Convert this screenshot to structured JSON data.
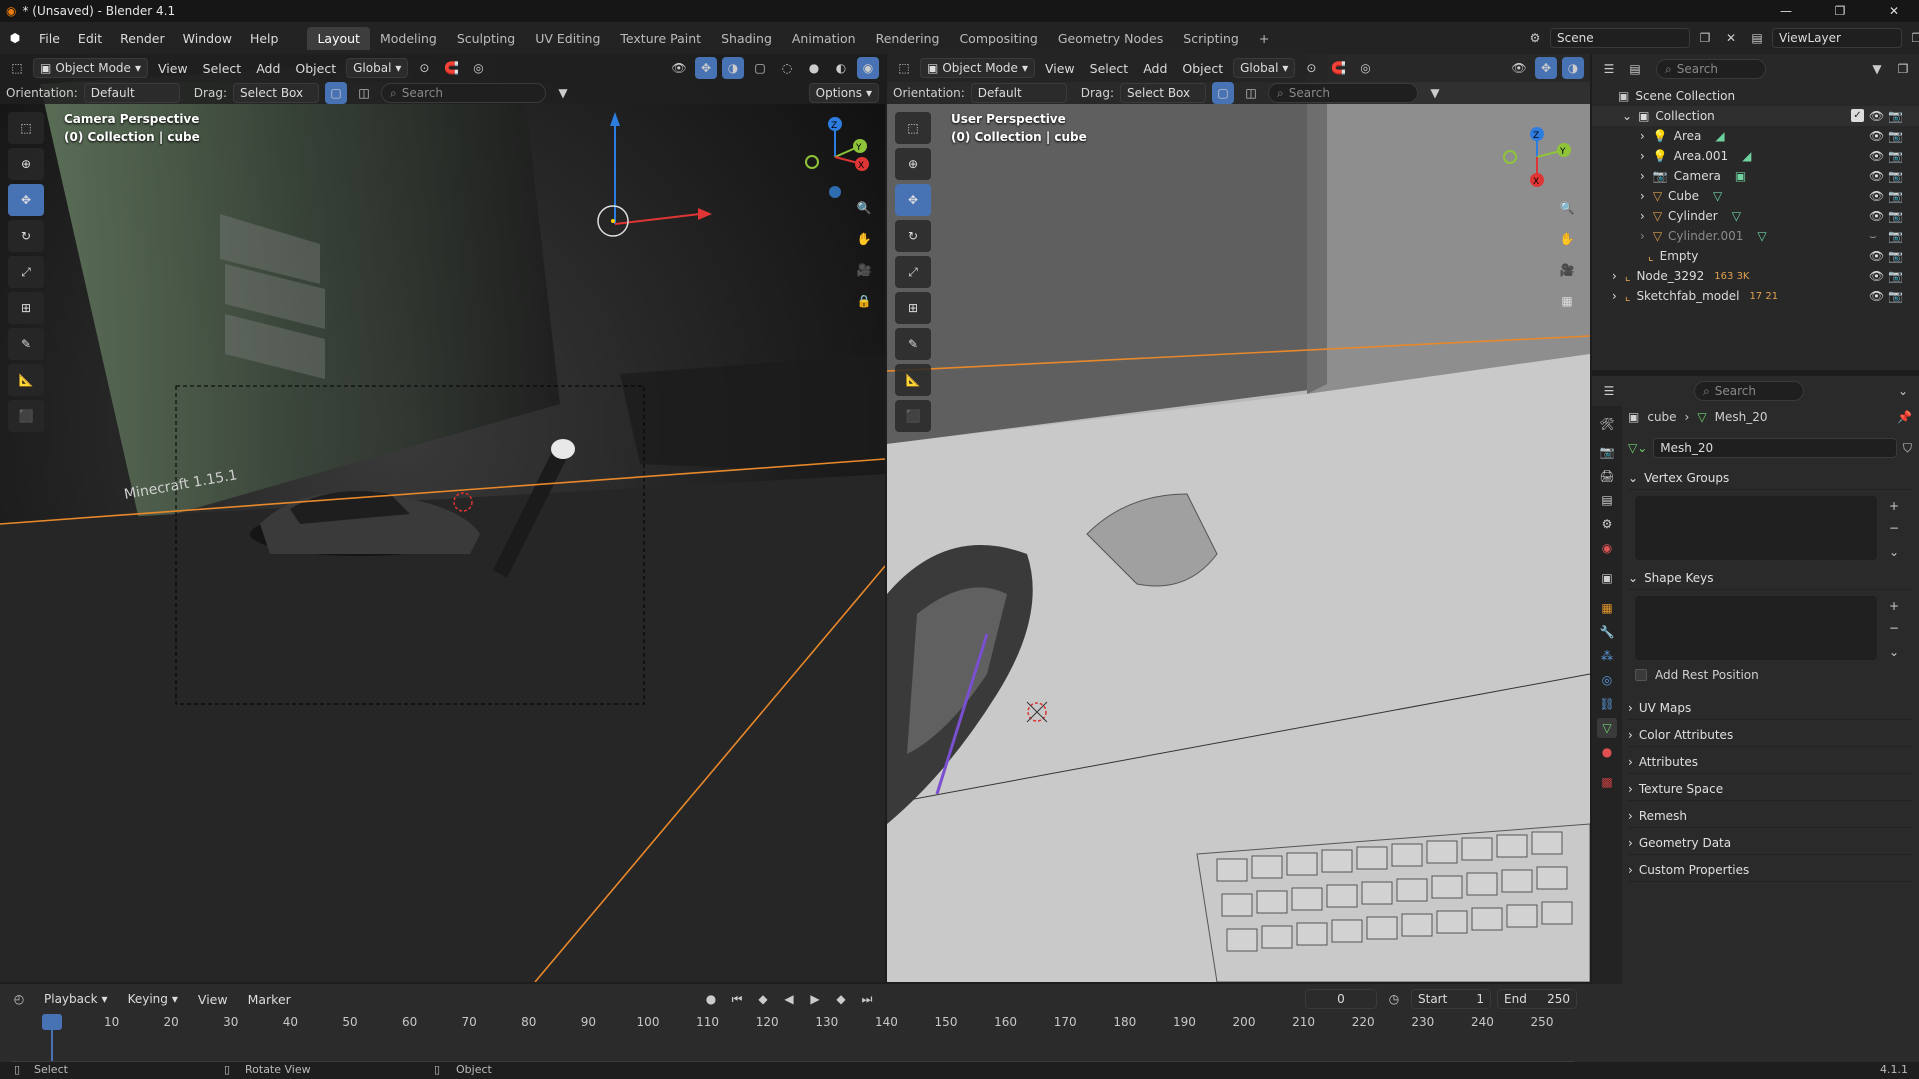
{
  "window": {
    "title": "* (Unsaved) - Blender 4.1"
  },
  "menu": {
    "items": [
      "File",
      "Edit",
      "Render",
      "Window",
      "Help"
    ]
  },
  "workspaces": [
    "Layout",
    "Modeling",
    "Sculpting",
    "UV Editing",
    "Texture Paint",
    "Shading",
    "Animation",
    "Rendering",
    "Compositing",
    "Geometry Nodes",
    "Scripting"
  ],
  "active_workspace": "Layout",
  "scene": {
    "name": "Scene",
    "view_layer": "ViewLayer"
  },
  "viewport_left": {
    "mode": "Object Mode",
    "menus": [
      "View",
      "Select",
      "Add",
      "Object"
    ],
    "transform": "Global",
    "orientation_label": "Orientation:",
    "orientation_value": "Default",
    "drag_label": "Drag:",
    "drag_value": "Select Box",
    "search_placeholder": "Search",
    "options": "Options",
    "perspective": "Camera Perspective",
    "collection_info": "(0) Collection | cube",
    "scene_text": "Minecraft 1.15.1"
  },
  "viewport_right": {
    "mode": "Object Mode",
    "menus": [
      "View",
      "Select",
      "Add",
      "Object"
    ],
    "transform": "Global",
    "orientation_label": "Orientation:",
    "orientation_value": "Default",
    "drag_label": "Drag:",
    "drag_value": "Select Box",
    "search_placeholder": "Search",
    "perspective": "User Perspective",
    "collection_info": "(0) Collection | cube"
  },
  "outliner": {
    "search_placeholder": "Search",
    "root": "Scene Collection",
    "collection": "Collection",
    "items": [
      {
        "name": "Area",
        "type": "light"
      },
      {
        "name": "Area.001",
        "type": "light"
      },
      {
        "name": "Camera",
        "type": "camera"
      },
      {
        "name": "Cube",
        "type": "mesh"
      },
      {
        "name": "Cylinder",
        "type": "mesh"
      },
      {
        "name": "Cylinder.001",
        "type": "mesh",
        "hidden": true
      },
      {
        "name": "Empty",
        "type": "empty"
      }
    ],
    "top_items": [
      {
        "name": "Node_3292",
        "badge": "163 3K"
      },
      {
        "name": "Sketchfab_model",
        "badge": "17  21"
      }
    ]
  },
  "properties": {
    "search_placeholder": "Search",
    "breadcrumb_object": "cube",
    "breadcrumb_data": "Mesh_20",
    "datablock": "Mesh_20",
    "panels_open": [
      "Vertex Groups",
      "Shape Keys"
    ],
    "add_rest_position": "Add Rest Position",
    "panels_closed": [
      "UV Maps",
      "Color Attributes",
      "Attributes",
      "Texture Space",
      "Remesh",
      "Geometry Data",
      "Custom Properties"
    ]
  },
  "timeline": {
    "menus": [
      "Playback",
      "Keying",
      "View",
      "Marker"
    ],
    "current_frame": "0",
    "start_label": "Start",
    "start": "1",
    "end_label": "End",
    "end": "250",
    "ticks": [
      "0",
      "10",
      "20",
      "30",
      "40",
      "50",
      "60",
      "70",
      "80",
      "90",
      "100",
      "110",
      "120",
      "130",
      "140",
      "150",
      "160",
      "170",
      "180",
      "190",
      "200",
      "210",
      "220",
      "230",
      "240",
      "250"
    ]
  },
  "statusbar": {
    "select": "Select",
    "rotate": "Rotate View",
    "object": "Object",
    "version": "4.1.1"
  },
  "colors": {
    "accent": "#4772b3",
    "selection_orange": "#e8882a",
    "panel_bg": "#2a2a2a",
    "timeline_cursor": "#4772b3"
  }
}
